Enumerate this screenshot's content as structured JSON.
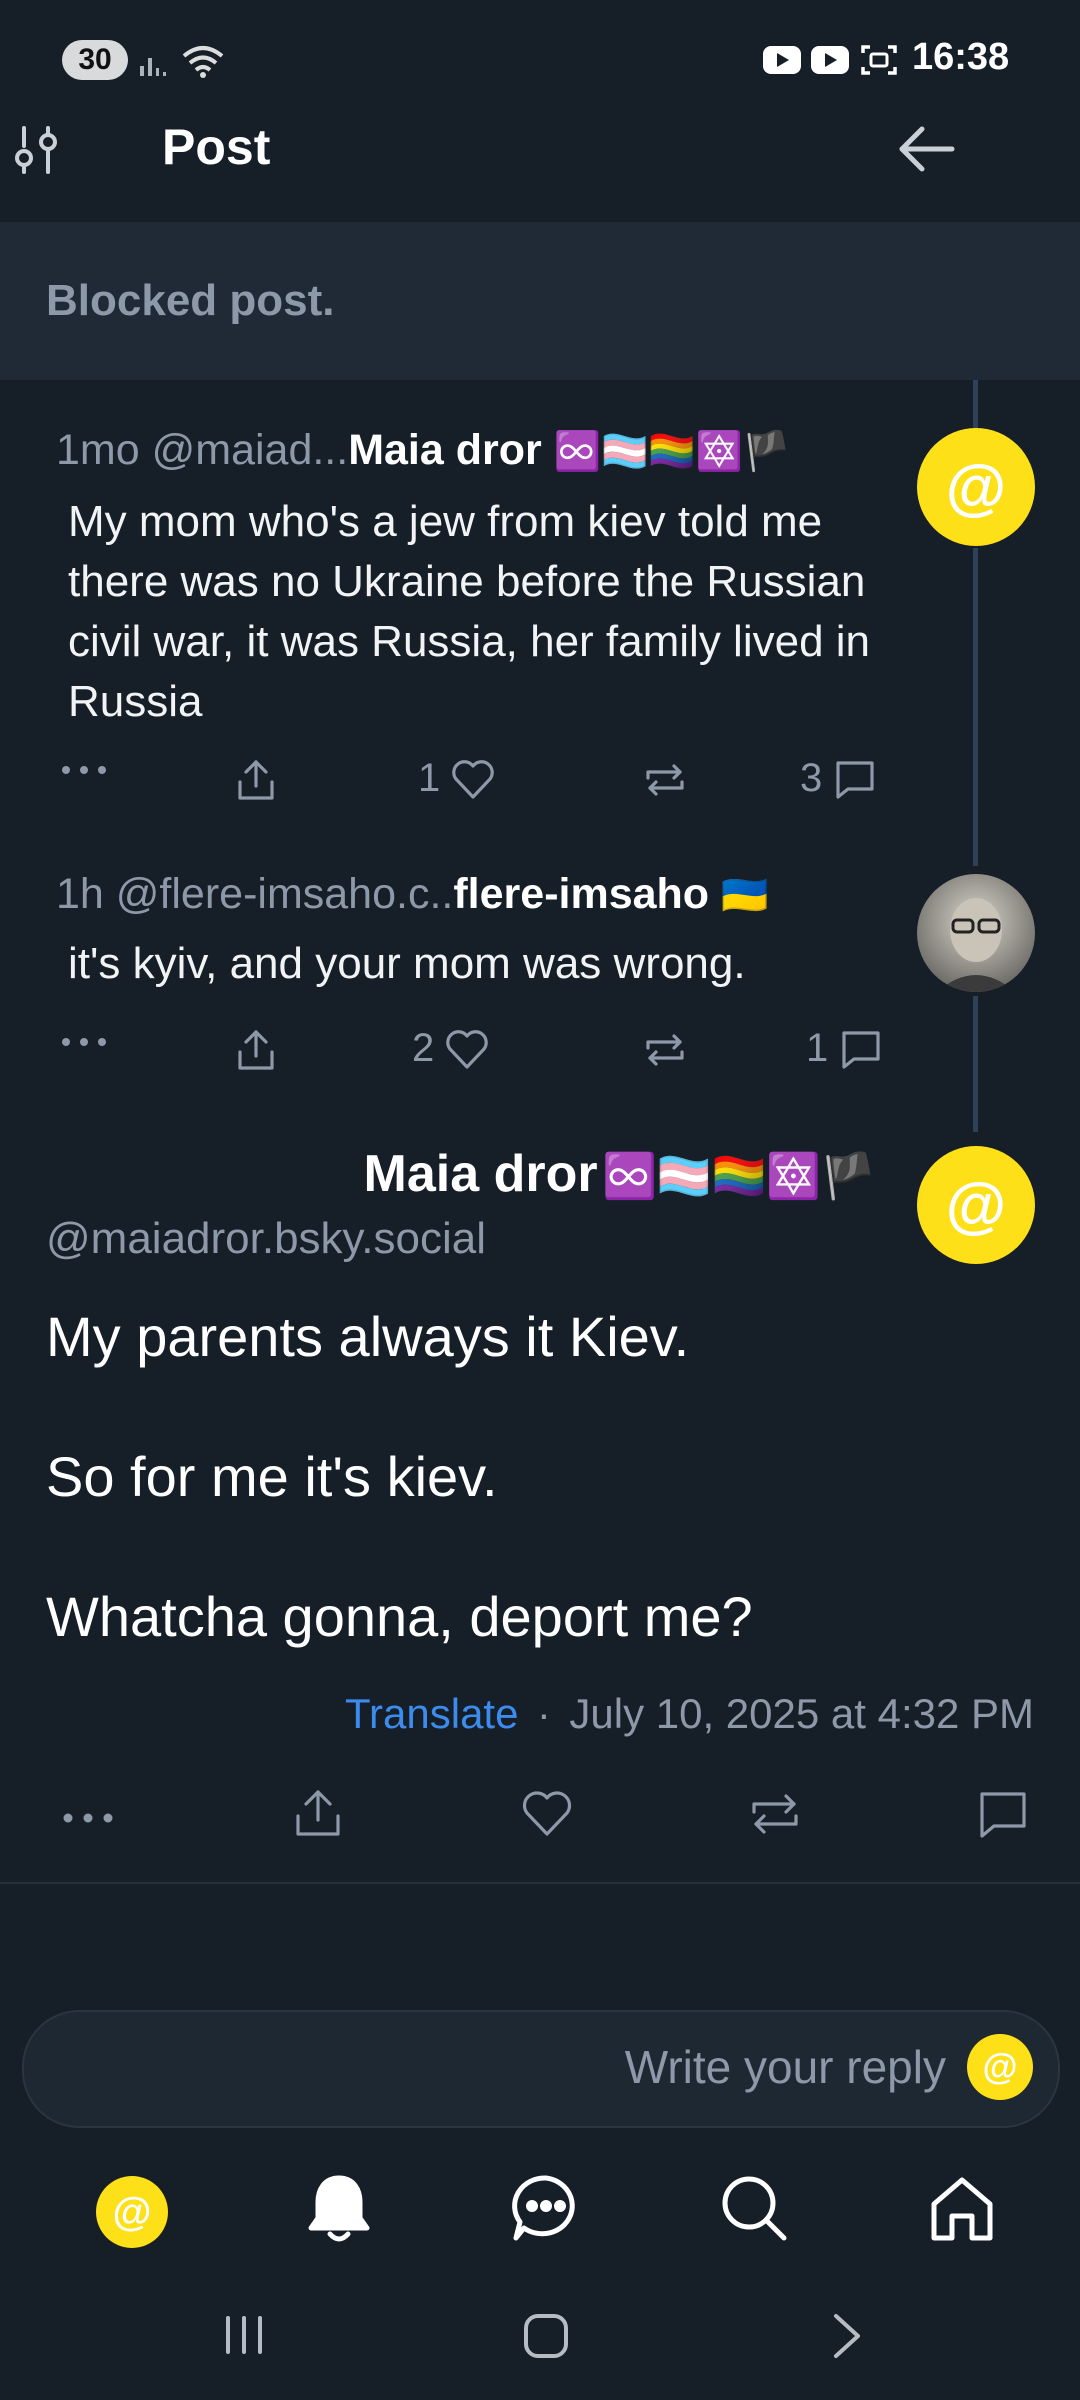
{
  "status": {
    "battery": "30",
    "time": "16:38"
  },
  "header": {
    "title": "Post"
  },
  "blocked": {
    "text": "Blocked post."
  },
  "reply1": {
    "meta": "1mo @maiad...",
    "name": "Maia dror",
    "name_emoji": "♾️🏳️‍⚧️🏳️‍🌈🔯🏴",
    "text": "My mom who's a jew from kiev told me there was no Ukraine before the Russian civil war, it was Russia, her family lived in Russia",
    "likes": "1",
    "replies": "3"
  },
  "reply2": {
    "meta": "1h @flere-imsaho.c..",
    "name": "flere-imsaho",
    "name_emoji": "🇺🇦",
    "text": "it's kyiv, and your mom was wrong.",
    "likes": "2",
    "replies": "1"
  },
  "main_post": {
    "name": "Maia dror",
    "name_emoji": "♾️🏳️‍⚧️🏳️‍🌈🔯🏴",
    "handle": "@maiadror.bsky.social",
    "line1": "My parents always it Kiev.",
    "line2": "So for me it's kiev.",
    "line3": "Whatcha gonna, deport me?",
    "translate": "Translate",
    "separator": "·",
    "timestamp": "July 10, 2025 at 4:32 PM"
  },
  "reply_box": {
    "placeholder": "Write your reply"
  },
  "colors": {
    "background": "#161e27",
    "accent": "#3c8cf0",
    "avatar_yellow": "#fde017",
    "muted": "#8d99a8"
  },
  "icons": [
    "filter-icon",
    "back-arrow-icon",
    "more-icon",
    "share-icon",
    "heart-icon",
    "repost-icon",
    "comment-icon",
    "bell-icon",
    "chat-icon",
    "search-icon",
    "home-icon"
  ]
}
